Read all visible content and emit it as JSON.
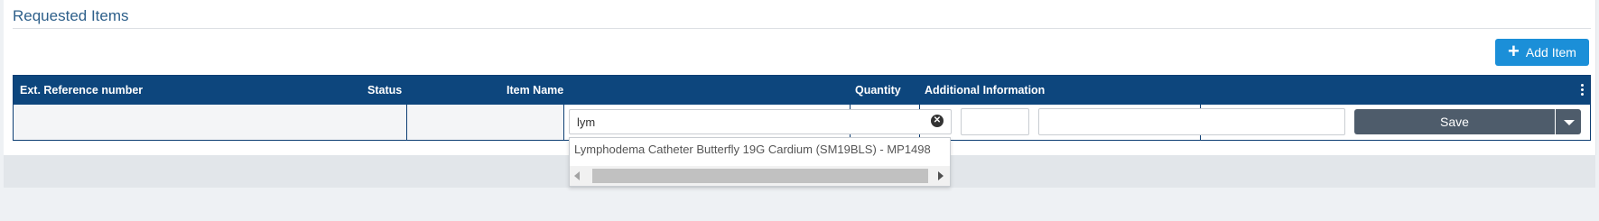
{
  "section": {
    "title": "Requested Items"
  },
  "toolbar": {
    "add_item_label": "Add Item",
    "add_icon": "plus-icon"
  },
  "table": {
    "columns": [
      "Ext. Reference number",
      "Status",
      "Item Name",
      "Quantity",
      "Additional Information"
    ],
    "row": {
      "ext_reference": "",
      "status": "",
      "item_name_value": "lym",
      "quantity_value": "",
      "additional_info_value": "",
      "save_label": "Save"
    }
  },
  "autocomplete": {
    "suggestions": [
      "Lymphodema Catheter Butterfly 19G Cardium (SM19BLS) - MP1498"
    ]
  },
  "colors": {
    "header_bg": "#0d467d",
    "accent_button": "#1b8fd8",
    "save_button": "#4e5c6b",
    "title_text": "#2d5f8a"
  }
}
